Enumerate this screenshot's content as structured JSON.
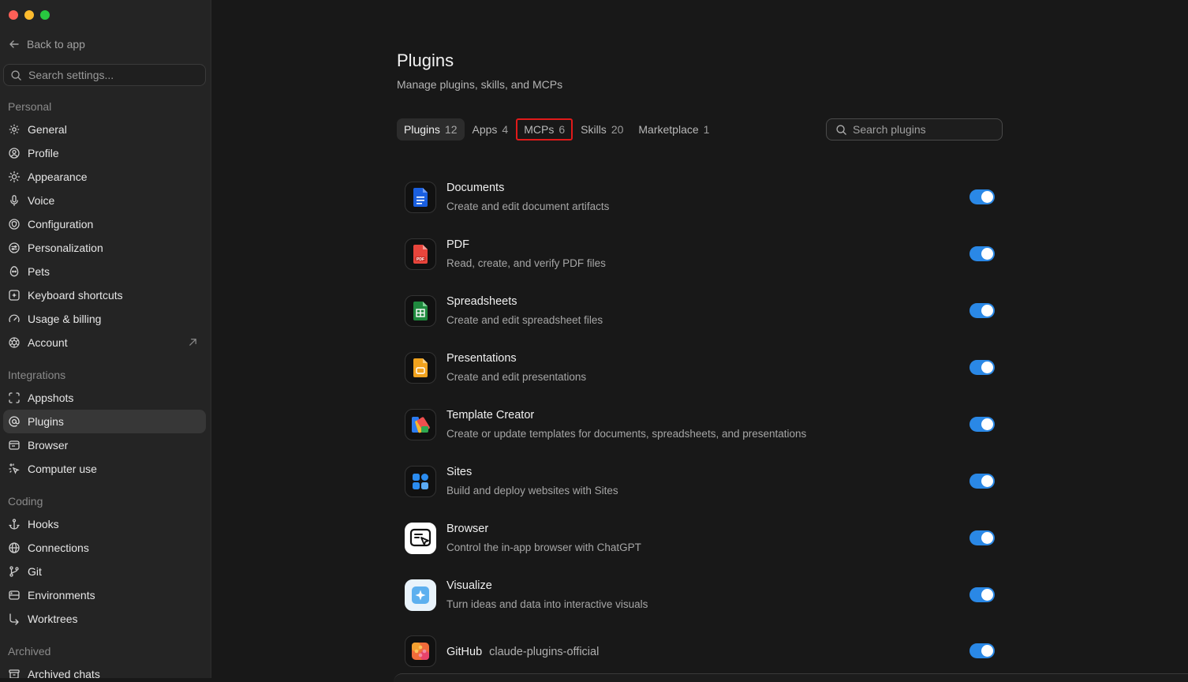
{
  "window": {
    "colors": {
      "close": "#ff5f57",
      "minimize": "#febc2e",
      "zoom": "#28c840"
    }
  },
  "sidebar": {
    "back_label": "Back to app",
    "search_placeholder": "Search settings...",
    "sections": [
      {
        "label": "Personal",
        "items": [
          {
            "label": "General",
            "icon": "gear-icon"
          },
          {
            "label": "Profile",
            "icon": "user-circle-icon"
          },
          {
            "label": "Appearance",
            "icon": "sun-icon"
          },
          {
            "label": "Voice",
            "icon": "microphone-icon"
          },
          {
            "label": "Configuration",
            "icon": "shield-icon"
          },
          {
            "label": "Personalization",
            "icon": "sliders-circle-icon"
          },
          {
            "label": "Pets",
            "icon": "egg-icon"
          },
          {
            "label": "Keyboard shortcuts",
            "icon": "keyboard-icon"
          },
          {
            "label": "Usage & billing",
            "icon": "gauge-icon"
          },
          {
            "label": "Account",
            "icon": "openai-logo-icon",
            "external": true
          }
        ]
      },
      {
        "label": "Integrations",
        "items": [
          {
            "label": "Appshots",
            "icon": "frame-icon"
          },
          {
            "label": "Plugins",
            "icon": "at-icon",
            "active": true
          },
          {
            "label": "Browser",
            "icon": "browser-window-icon"
          },
          {
            "label": "Computer use",
            "icon": "cursor-sparkle-icon"
          }
        ]
      },
      {
        "label": "Coding",
        "items": [
          {
            "label": "Hooks",
            "icon": "anchor-icon"
          },
          {
            "label": "Connections",
            "icon": "globe-icon"
          },
          {
            "label": "Git",
            "icon": "git-branch-icon"
          },
          {
            "label": "Environments",
            "icon": "server-icon"
          },
          {
            "label": "Worktrees",
            "icon": "worktree-icon"
          }
        ]
      },
      {
        "label": "Archived",
        "items": [
          {
            "label": "Archived chats",
            "icon": "archive-icon"
          }
        ]
      }
    ]
  },
  "main": {
    "title": "Plugins",
    "subtitle": "Manage plugins, skills, and MCPs",
    "tabs": [
      {
        "label": "Plugins",
        "count": "12",
        "active": true
      },
      {
        "label": "Apps",
        "count": "4"
      },
      {
        "label": "MCPs",
        "count": "6",
        "highlighted": true
      },
      {
        "label": "Skills",
        "count": "20"
      },
      {
        "label": "Marketplace",
        "count": "1"
      }
    ],
    "search_placeholder": "Search plugins",
    "plugins": [
      {
        "name": "Documents",
        "description": "Create and edit document artifacts",
        "icon": "document-icon",
        "enabled": true
      },
      {
        "name": "PDF",
        "description": "Read, create, and verify PDF files",
        "icon": "pdf-file-icon",
        "enabled": true
      },
      {
        "name": "Spreadsheets",
        "description": "Create and edit spreadsheet files",
        "icon": "spreadsheet-icon",
        "enabled": true
      },
      {
        "name": "Presentations",
        "description": "Create and edit presentations",
        "icon": "presentation-icon",
        "enabled": true
      },
      {
        "name": "Template Creator",
        "description": "Create or update templates for documents, spreadsheets, and presentations",
        "icon": "template-creator-icon",
        "enabled": true
      },
      {
        "name": "Sites",
        "description": "Build and deploy websites with Sites",
        "icon": "sites-grid-icon",
        "enabled": true
      },
      {
        "name": "Browser",
        "description": "Control the in-app browser with ChatGPT",
        "icon": "browser-cursor-icon",
        "enabled": true
      },
      {
        "name": "Visualize",
        "description": "Turn ideas and data into interactive visuals",
        "icon": "sparkle-visual-icon",
        "enabled": true
      },
      {
        "name": "GitHub",
        "source": "claude-plugins-official",
        "description": "",
        "icon": "puzzle-icon",
        "enabled": true
      }
    ],
    "accent": "#2a88e6",
    "highlight_color": "#e01a1a"
  }
}
